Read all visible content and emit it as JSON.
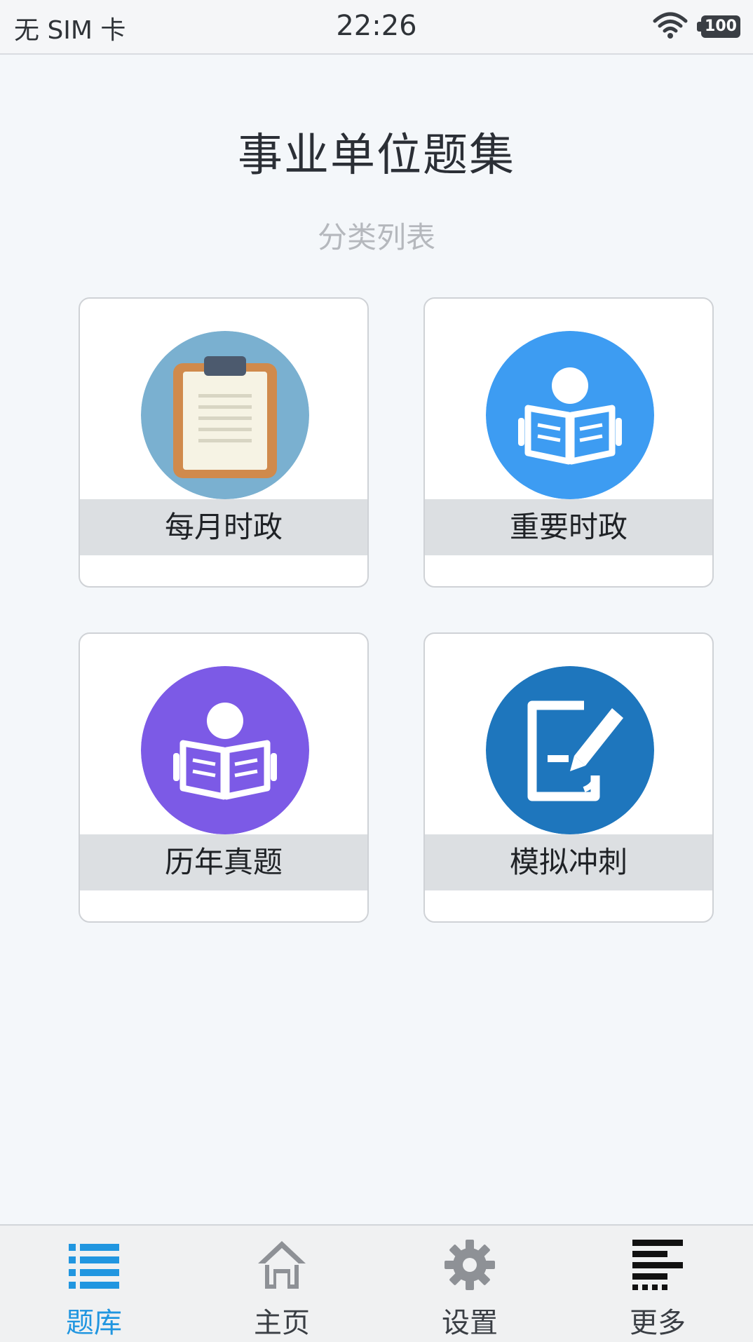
{
  "status_bar": {
    "carrier": "无 SIM 卡",
    "time": "22:26",
    "battery": "100"
  },
  "header": {
    "title": "事业单位题集",
    "subtitle": "分类列表"
  },
  "categories": [
    {
      "label": "每月时政",
      "icon": "clipboard-icon",
      "color": "#7ab0d0"
    },
    {
      "label": "重要时政",
      "icon": "reader-icon",
      "color": "#3d9cf2"
    },
    {
      "label": "历年真题",
      "icon": "reader-icon",
      "color": "#7c5ae6"
    },
    {
      "label": "模拟冲刺",
      "icon": "edit-document-icon",
      "color": "#1e76bd"
    }
  ],
  "tabbar": {
    "items": [
      {
        "label": "题库",
        "icon": "list-icon",
        "active": true
      },
      {
        "label": "主页",
        "icon": "home-icon",
        "active": false
      },
      {
        "label": "设置",
        "icon": "gear-icon",
        "active": false
      },
      {
        "label": "更多",
        "icon": "more-icon",
        "active": false
      }
    ],
    "active_color": "#2196e0"
  }
}
